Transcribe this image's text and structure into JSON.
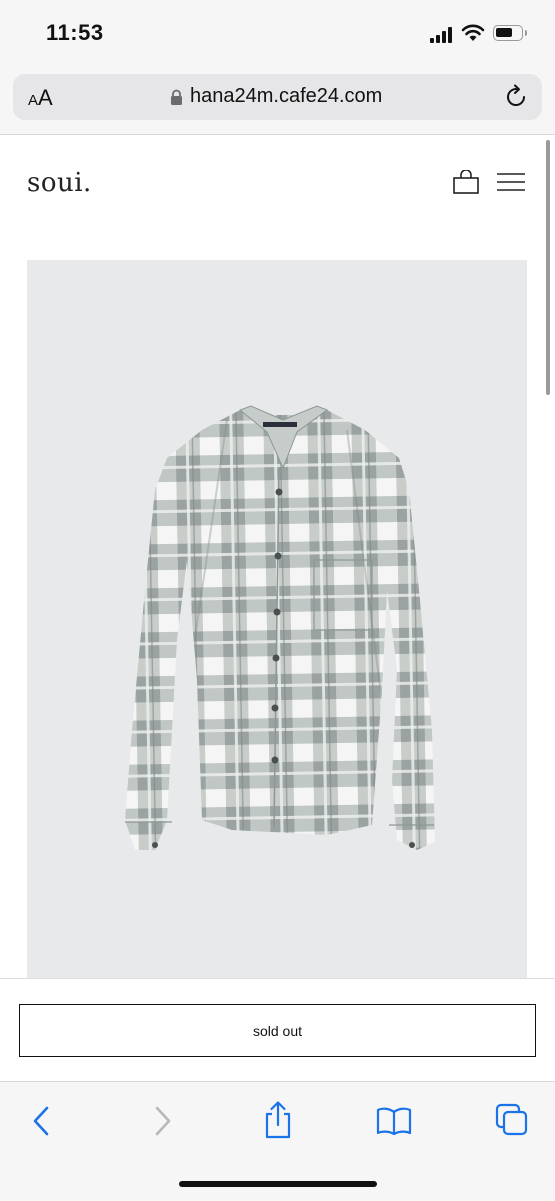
{
  "status_bar": {
    "time": "11:53",
    "battery_level": 0.7
  },
  "browser": {
    "text_size_label_small": "A",
    "text_size_label_large": "A",
    "url": "hana24m.cafe24.com",
    "icons": {
      "lock": "lock-icon",
      "reload": "reload-icon"
    }
  },
  "site": {
    "logo": "soui.",
    "icons": {
      "bag": "shopping-bag-icon",
      "menu": "hamburger-menu-icon"
    }
  },
  "product": {
    "image": "plaid-shirt-photo",
    "image_colors": {
      "background": "#e8e9eb",
      "plaid_gray": "#9aa3a1",
      "plaid_white": "#f4f5f4"
    },
    "cta_label": "sold out"
  },
  "toolbar": {
    "icons": [
      "back-chevron-icon",
      "forward-chevron-icon",
      "share-icon",
      "bookmarks-icon",
      "tabs-icon"
    ],
    "accent": "#1a73e8"
  }
}
